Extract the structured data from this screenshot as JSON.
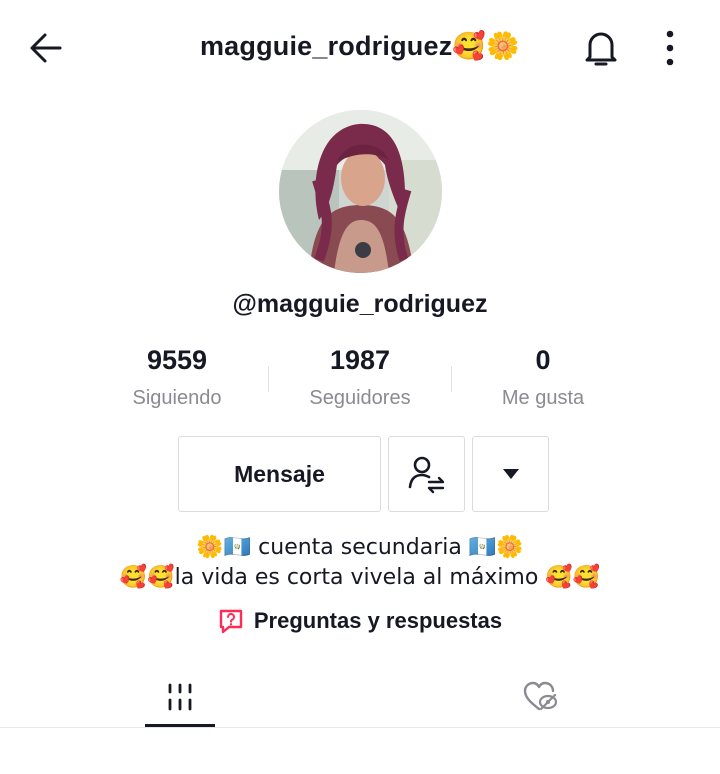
{
  "header": {
    "title": "magguie_rodriguez🥰🌼",
    "back_icon": "arrow-left-icon",
    "bell_icon": "bell-icon",
    "more_icon": "vertical-dots-icon"
  },
  "profile": {
    "handle": "@magguie_rodriguez"
  },
  "stats": [
    {
      "value": "9559",
      "label": "Siguiendo"
    },
    {
      "value": "1987",
      "label": "Seguidores"
    },
    {
      "value": "0",
      "label": "Me gusta"
    }
  ],
  "actions": {
    "message_label": "Mensaje",
    "follow_icon": "user-swap-icon",
    "dropdown_icon": "caret-down-icon"
  },
  "bio": {
    "line1": "🌼🇬🇹 cuenta secundaria 🇬🇹🌼",
    "line2": "🥰🥰la vida es corta vivela al máximo 🥰🥰"
  },
  "qa": {
    "label": "Preguntas y respuestas",
    "icon": "question-box-icon"
  },
  "tabs": [
    {
      "name": "videos",
      "icon": "grid-bars-icon",
      "active": true
    },
    {
      "name": "liked",
      "icon": "heart-hidden-icon",
      "active": false
    }
  ],
  "colors": {
    "text": "#161823",
    "muted": "#8a8b91",
    "accent": "#fe2c55",
    "border": "#dcdcde"
  }
}
